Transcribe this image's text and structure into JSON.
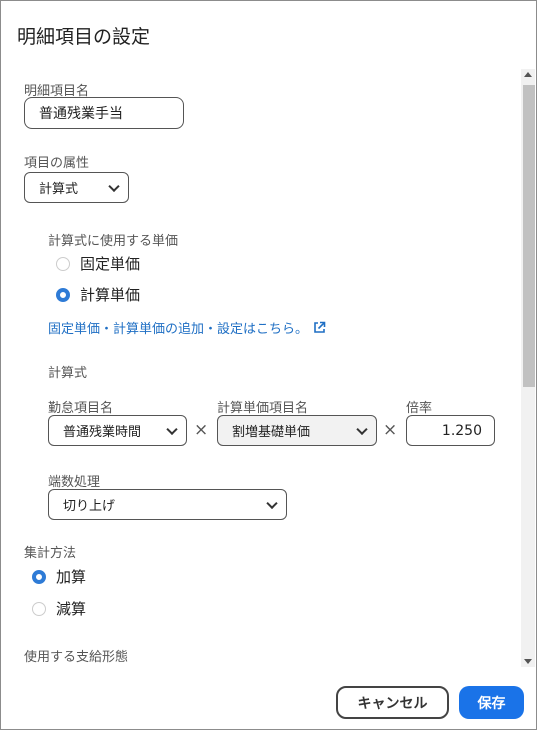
{
  "dialog": {
    "title": "明細項目の設定"
  },
  "item_name": {
    "label": "明細項目名",
    "value": "普通残業手当"
  },
  "attribute": {
    "label": "項目の属性",
    "selected": "計算式"
  },
  "unit_price": {
    "label": "計算式に使用する単価",
    "options": [
      {
        "label": "固定単価",
        "checked": false
      },
      {
        "label": "計算単価",
        "checked": true
      }
    ],
    "link_text": "固定単価・計算単価の追加・設定はこちら。"
  },
  "formula": {
    "label": "計算式",
    "attendance": {
      "label": "勤怠項目名",
      "selected": "普通残業時間"
    },
    "unit_item": {
      "label": "計算単価項目名",
      "selected": "割増基礎単価"
    },
    "multiplier": {
      "label": "倍率",
      "value": "1.250"
    },
    "times_symbol": "×"
  },
  "rounding": {
    "label": "端数処理",
    "selected": "切り上げ"
  },
  "aggregation": {
    "label": "集計方法",
    "options": [
      {
        "label": "加算",
        "checked": true
      },
      {
        "label": "減算",
        "checked": false
      }
    ]
  },
  "payment_type": {
    "label": "使用する支給形態"
  },
  "footer": {
    "cancel_label": "キャンセル",
    "save_label": "保存"
  },
  "colors": {
    "accent": "#1a73e8",
    "link": "#1f6fc4",
    "radio": "#2e7bd6"
  },
  "icons": {
    "dropdown": "chevron-down-icon",
    "external": "external-link-icon"
  }
}
